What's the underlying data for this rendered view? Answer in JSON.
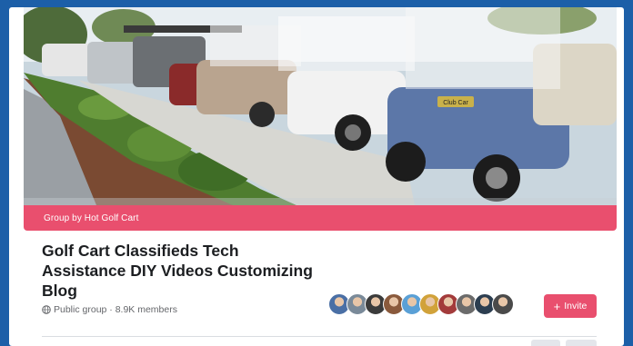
{
  "group": {
    "banner_text": "Group by Hot Golf Cart",
    "title": "Golf Cart Classifieds Tech Assistance DIY Videos Customizing Blog",
    "privacy_meta": "Public group · 8.9K members"
  },
  "actions": {
    "invite_label": "Invite"
  },
  "cover_photo": {
    "cart_sign": "Club Car"
  },
  "members": {
    "avatar_colors": [
      "#4a6fa5",
      "#7a8a99",
      "#3b3b3b",
      "#8a5a3c",
      "#5aa0d6",
      "#d1a23a",
      "#a33b3b",
      "#6b6b6b",
      "#2c3e50",
      "#4a4a4a"
    ]
  },
  "colors": {
    "accent": "#e94f6e",
    "frame": "#1c5fa8"
  }
}
